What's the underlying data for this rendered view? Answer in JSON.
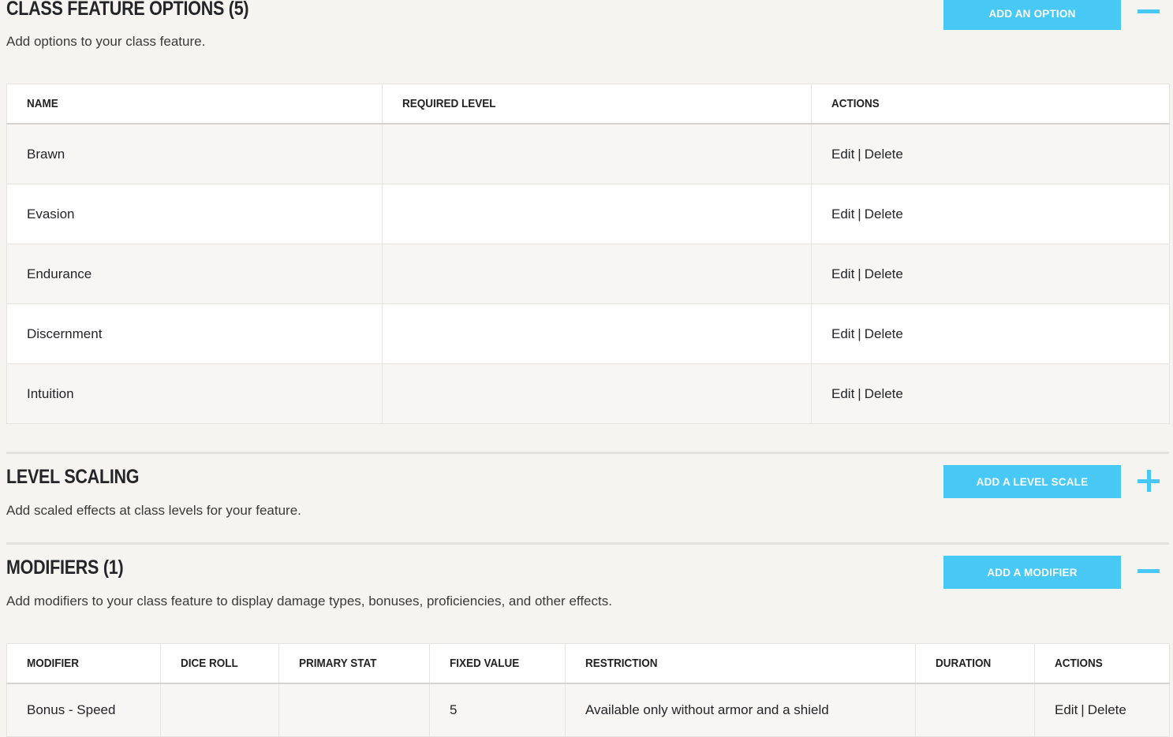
{
  "options": {
    "title": "CLASS FEATURE OPTIONS (5)",
    "description": "Add options to your class feature.",
    "add_button": "ADD AN OPTION",
    "toggle_state": "collapse",
    "columns": [
      "NAME",
      "REQUIRED LEVEL",
      "ACTIONS"
    ],
    "rows": [
      {
        "name": "Brawn",
        "required_level": "",
        "edit": "Edit",
        "sep": "|",
        "delete": "Delete"
      },
      {
        "name": "Evasion",
        "required_level": "",
        "edit": "Edit",
        "sep": "|",
        "delete": "Delete"
      },
      {
        "name": "Endurance",
        "required_level": "",
        "edit": "Edit",
        "sep": "|",
        "delete": "Delete"
      },
      {
        "name": "Discernment",
        "required_level": "",
        "edit": "Edit",
        "sep": "|",
        "delete": "Delete"
      },
      {
        "name": "Intuition",
        "required_level": "",
        "edit": "Edit",
        "sep": "|",
        "delete": "Delete"
      }
    ]
  },
  "level_scaling": {
    "title": "LEVEL SCALING",
    "description": "Add scaled effects at class levels for your feature.",
    "add_button": "ADD A LEVEL SCALE",
    "toggle_state": "expand"
  },
  "modifiers": {
    "title": "MODIFIERS (1)",
    "description": "Add modifiers to your class feature to display damage types, bonuses, proficiencies, and other effects.",
    "add_button": "ADD A MODIFIER",
    "toggle_state": "collapse",
    "columns": [
      "MODIFIER",
      "DICE ROLL",
      "PRIMARY STAT",
      "FIXED VALUE",
      "RESTRICTION",
      "DURATION",
      "ACTIONS"
    ],
    "rows": [
      {
        "modifier": "Bonus - Speed",
        "dice_roll": "",
        "primary_stat": "",
        "fixed_value": "5",
        "restriction": "Available only without armor and a shield",
        "duration": "",
        "edit": "Edit",
        "sep": "|",
        "delete": "Delete"
      }
    ]
  },
  "colors": {
    "accent": "#47c8f5",
    "background": "#f6f4f0",
    "text": "#242528"
  },
  "icons": {
    "collapse": "minus-icon",
    "expand": "plus-icon"
  }
}
